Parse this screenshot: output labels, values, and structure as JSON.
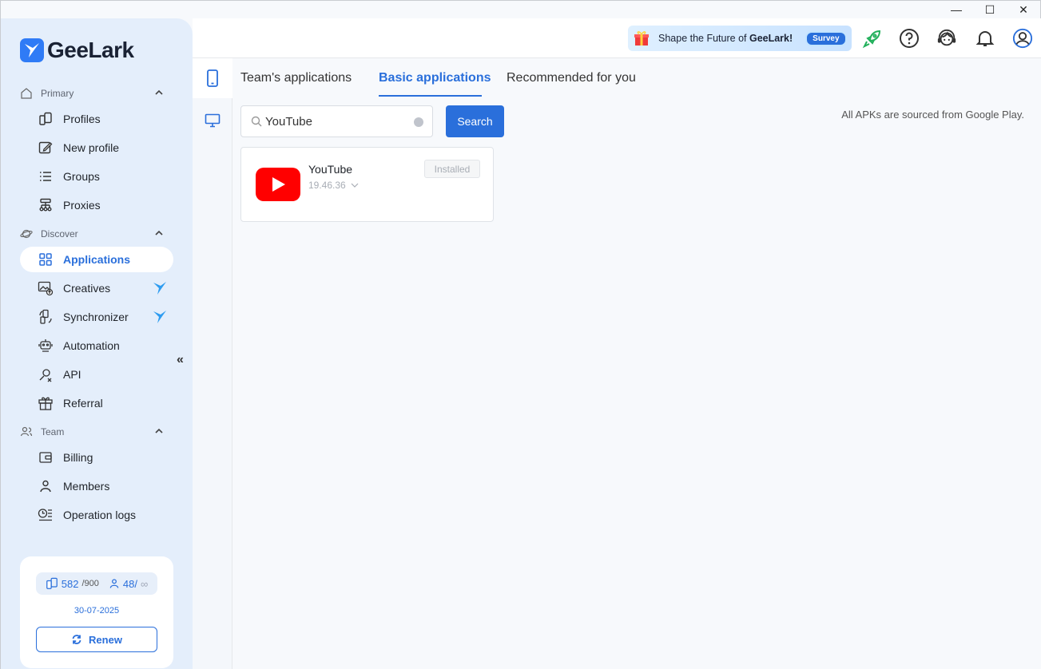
{
  "window": {
    "controls": [
      "—",
      "☐",
      "✕"
    ]
  },
  "sidebar": {
    "logo_text": "GeeLark",
    "sections": {
      "primary": "Primary",
      "discover": "Discover",
      "team": "Team"
    },
    "items": [
      {
        "id": "profiles",
        "label": "Profiles",
        "icon": "profiles-icon"
      },
      {
        "id": "new-profile",
        "label": "New profile",
        "icon": "edit-icon"
      },
      {
        "id": "groups",
        "label": "Groups",
        "icon": "list-icon"
      },
      {
        "id": "proxies",
        "label": "Proxies",
        "icon": "network-icon"
      },
      {
        "id": "applications",
        "label": "Applications",
        "icon": "grid-icon",
        "active": true
      },
      {
        "id": "creatives",
        "label": "Creatives",
        "icon": "image-upload-icon"
      },
      {
        "id": "synchronizer",
        "label": "Synchronizer",
        "icon": "sync-icon"
      },
      {
        "id": "automation",
        "label": "Automation",
        "icon": "robot-icon"
      },
      {
        "id": "api",
        "label": "API",
        "icon": "api-icon"
      },
      {
        "id": "referral",
        "label": "Referral",
        "icon": "gift-icon"
      },
      {
        "id": "billing",
        "label": "Billing",
        "icon": "wallet-icon"
      },
      {
        "id": "members",
        "label": "Members",
        "icon": "user-icon"
      },
      {
        "id": "operation-logs",
        "label": "Operation logs",
        "icon": "log-icon"
      }
    ],
    "collapse_glyph": "«",
    "quota": {
      "profiles_used": "582",
      "profiles_total": "/900",
      "members_used": "48/",
      "members_total": "∞"
    },
    "expiry_date": "30-07-2025",
    "renew_label": "Renew"
  },
  "header": {
    "survey_text_prefix": "Shape the Future of ",
    "survey_text_brand": "GeeLark!",
    "survey_badge": "Survey",
    "icons": [
      "rocket-icon",
      "help-icon",
      "support-icon",
      "bell-icon",
      "account-icon"
    ]
  },
  "main": {
    "tabs": [
      {
        "label": "Team's applications"
      },
      {
        "label": "Basic applications",
        "active": true
      },
      {
        "label": "Recommended for you"
      }
    ],
    "search": {
      "value": "YouTube",
      "button_label": "Search"
    },
    "apk_note": "All APKs are sourced from Google Play.",
    "apps": [
      {
        "name": "YouTube",
        "version": "19.46.36",
        "status": "Installed",
        "brand_color": "#ff0000"
      }
    ]
  },
  "colors": {
    "accent": "#2a6fdb",
    "sidebar_bg": "#e4eefb",
    "rocket": "#22b05b"
  }
}
